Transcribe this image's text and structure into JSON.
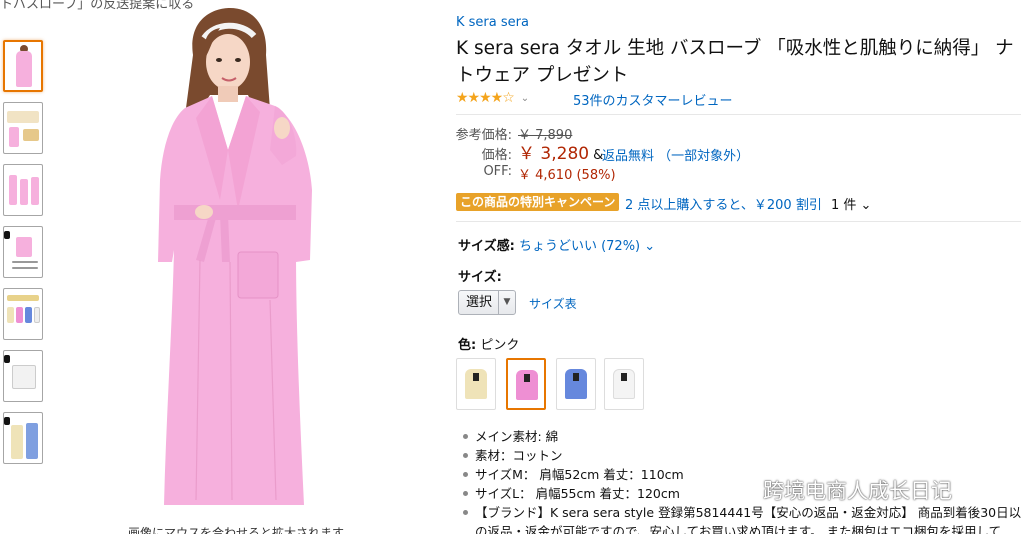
{
  "top_cut_text": "トバスローブ」の反送提案に収る",
  "gallery": {
    "caption": "画像にマウスを合わせると拡大されます",
    "thumbnails": [
      "thumb-pink-model",
      "thumb-banner",
      "thumb-three-models",
      "thumb-size-chart",
      "thumb-color-variants",
      "thumb-detail",
      "thumb-couple"
    ]
  },
  "product": {
    "brand": "K sera sera",
    "title": "K sera sera タオル 生地 バスローブ 「吸水性と肌触りに納得」 ナトウェア プレゼント",
    "rating_stars": "★★★★☆",
    "rating_chevron": "⌄",
    "review_count": "53件のカスタマーレビュー"
  },
  "price": {
    "list_label": "参考価格:",
    "list_value": "￥ 7,890",
    "price_label": "価格:",
    "price_value": "￥ 3,280",
    "amp": "&",
    "returns": "返品無料 （一部対象外）",
    "off_label": "OFF:",
    "off_value": "￥ 4,610 (58%)"
  },
  "promo": {
    "badge": "この商品の特別キャンペーン",
    "text": "2 点以上購入すると、￥200 割引",
    "qty": "1 件 ⌄"
  },
  "fit": {
    "label": "サイズ感:",
    "value": "ちょうどいい (72%) ⌄"
  },
  "size": {
    "label": "サイズ:",
    "selected": "選択",
    "chart_link": "サイズ表"
  },
  "color": {
    "label": "色:",
    "selected": "ピンク",
    "swatches": [
      {
        "name": "beige",
        "color": "#efe3b8"
      },
      {
        "name": "pink",
        "color": "#ee8fd3"
      },
      {
        "name": "blue",
        "color": "#6688dd"
      },
      {
        "name": "white",
        "color": "#f4f4f4"
      }
    ]
  },
  "bullets": [
    "メイン素材: 綿",
    "素材：コットン",
    "サイズM： 肩幅52cm 着丈：110cm",
    "サイズL： 肩幅55cm 着丈：120cm",
    "【ブランド】K sera sera style 登録第5814441号【安心の返品・返金対応】 商品到着後30日以",
    "の返品・返金が可能ですので、安心してお買い求め頂けます。 また梱包はエコ梱包を採用して"
  ],
  "watermark": "跨境电商人成长日记",
  "colors": {
    "link": "#0066c0",
    "price": "#b12704",
    "stars": "#f4a41c",
    "promo_badge": "#e8a229",
    "selected_border": "#e77600",
    "robe_pink": "#f6b0dd"
  }
}
